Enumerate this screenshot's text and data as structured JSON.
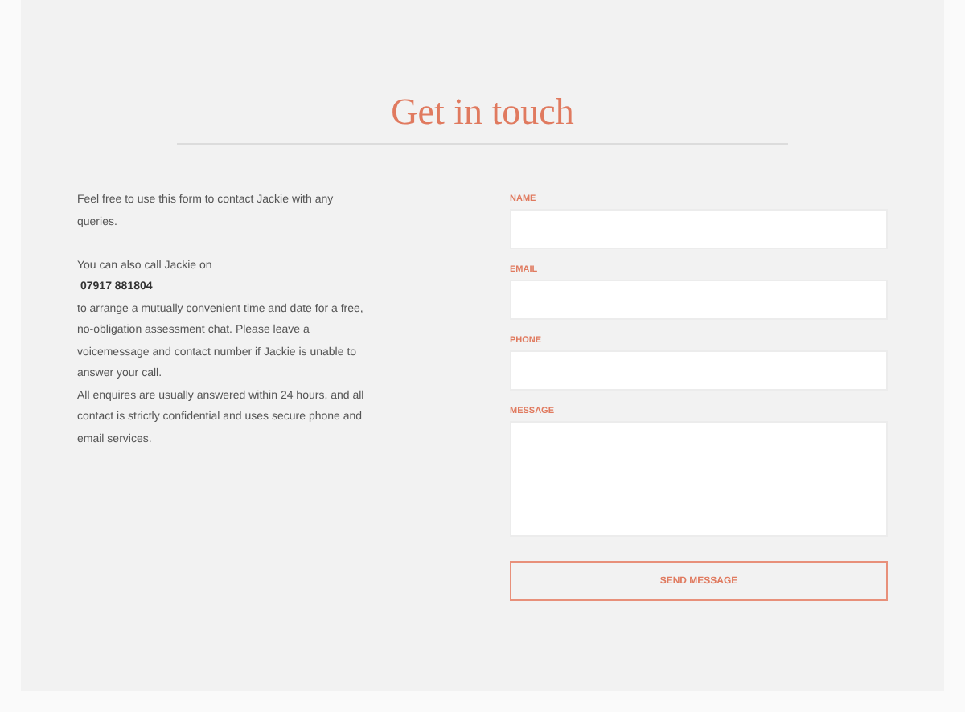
{
  "title": "Get in touch",
  "intro": [
    {
      "kind": "text",
      "text": "Feel free to use this form to contact Jackie with any queries."
    },
    {
      "kind": "gap"
    },
    {
      "kind": "text",
      "text": "You can also call Jackie on"
    },
    {
      "kind": "phone",
      "text": "07917 881804"
    },
    {
      "kind": "text",
      "text": "to arrange a mutually convenient time and date for a free, no-obligation assessment chat. Please leave a voicemessage and contact number if Jackie is unable to answer your call."
    },
    {
      "kind": "text",
      "text": "All enquires are usually answered within 24 hours, and all contact is strictly confidential and uses secure phone and email services."
    }
  ],
  "fields": [
    {
      "label": "NAME",
      "kind": "input"
    },
    {
      "label": "EMAIL",
      "kind": "input"
    },
    {
      "label": "PHONE",
      "kind": "input"
    },
    {
      "label": "MESSAGE",
      "kind": "textarea"
    }
  ],
  "submit": "SEND MESSAGE"
}
